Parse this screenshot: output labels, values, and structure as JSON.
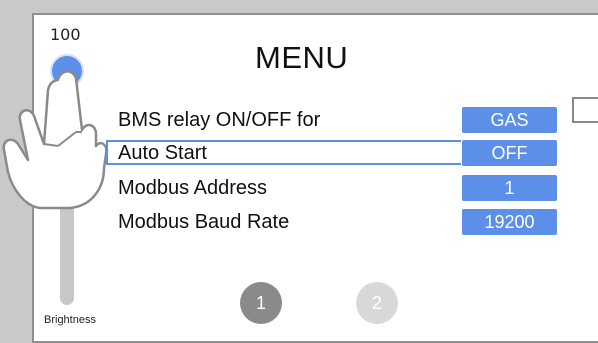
{
  "brightness": {
    "value": "100",
    "label": "Brightness",
    "level_percent": 100
  },
  "menu": {
    "title": "MENU",
    "rows": [
      {
        "label": "BMS relay ON/OFF for",
        "value": "GAS"
      },
      {
        "label": "Auto Start",
        "value": "OFF",
        "selected": true
      },
      {
        "label": "Modbus Address",
        "value": "1"
      },
      {
        "label": "Modbus Baud Rate",
        "value": "19200"
      }
    ]
  },
  "pagination": {
    "pages": [
      "1",
      "2"
    ],
    "current": "1"
  },
  "colors": {
    "accent": "#5b8fe8",
    "active_page": "#8a8a8a",
    "inactive_page": "#d8d8d8"
  }
}
